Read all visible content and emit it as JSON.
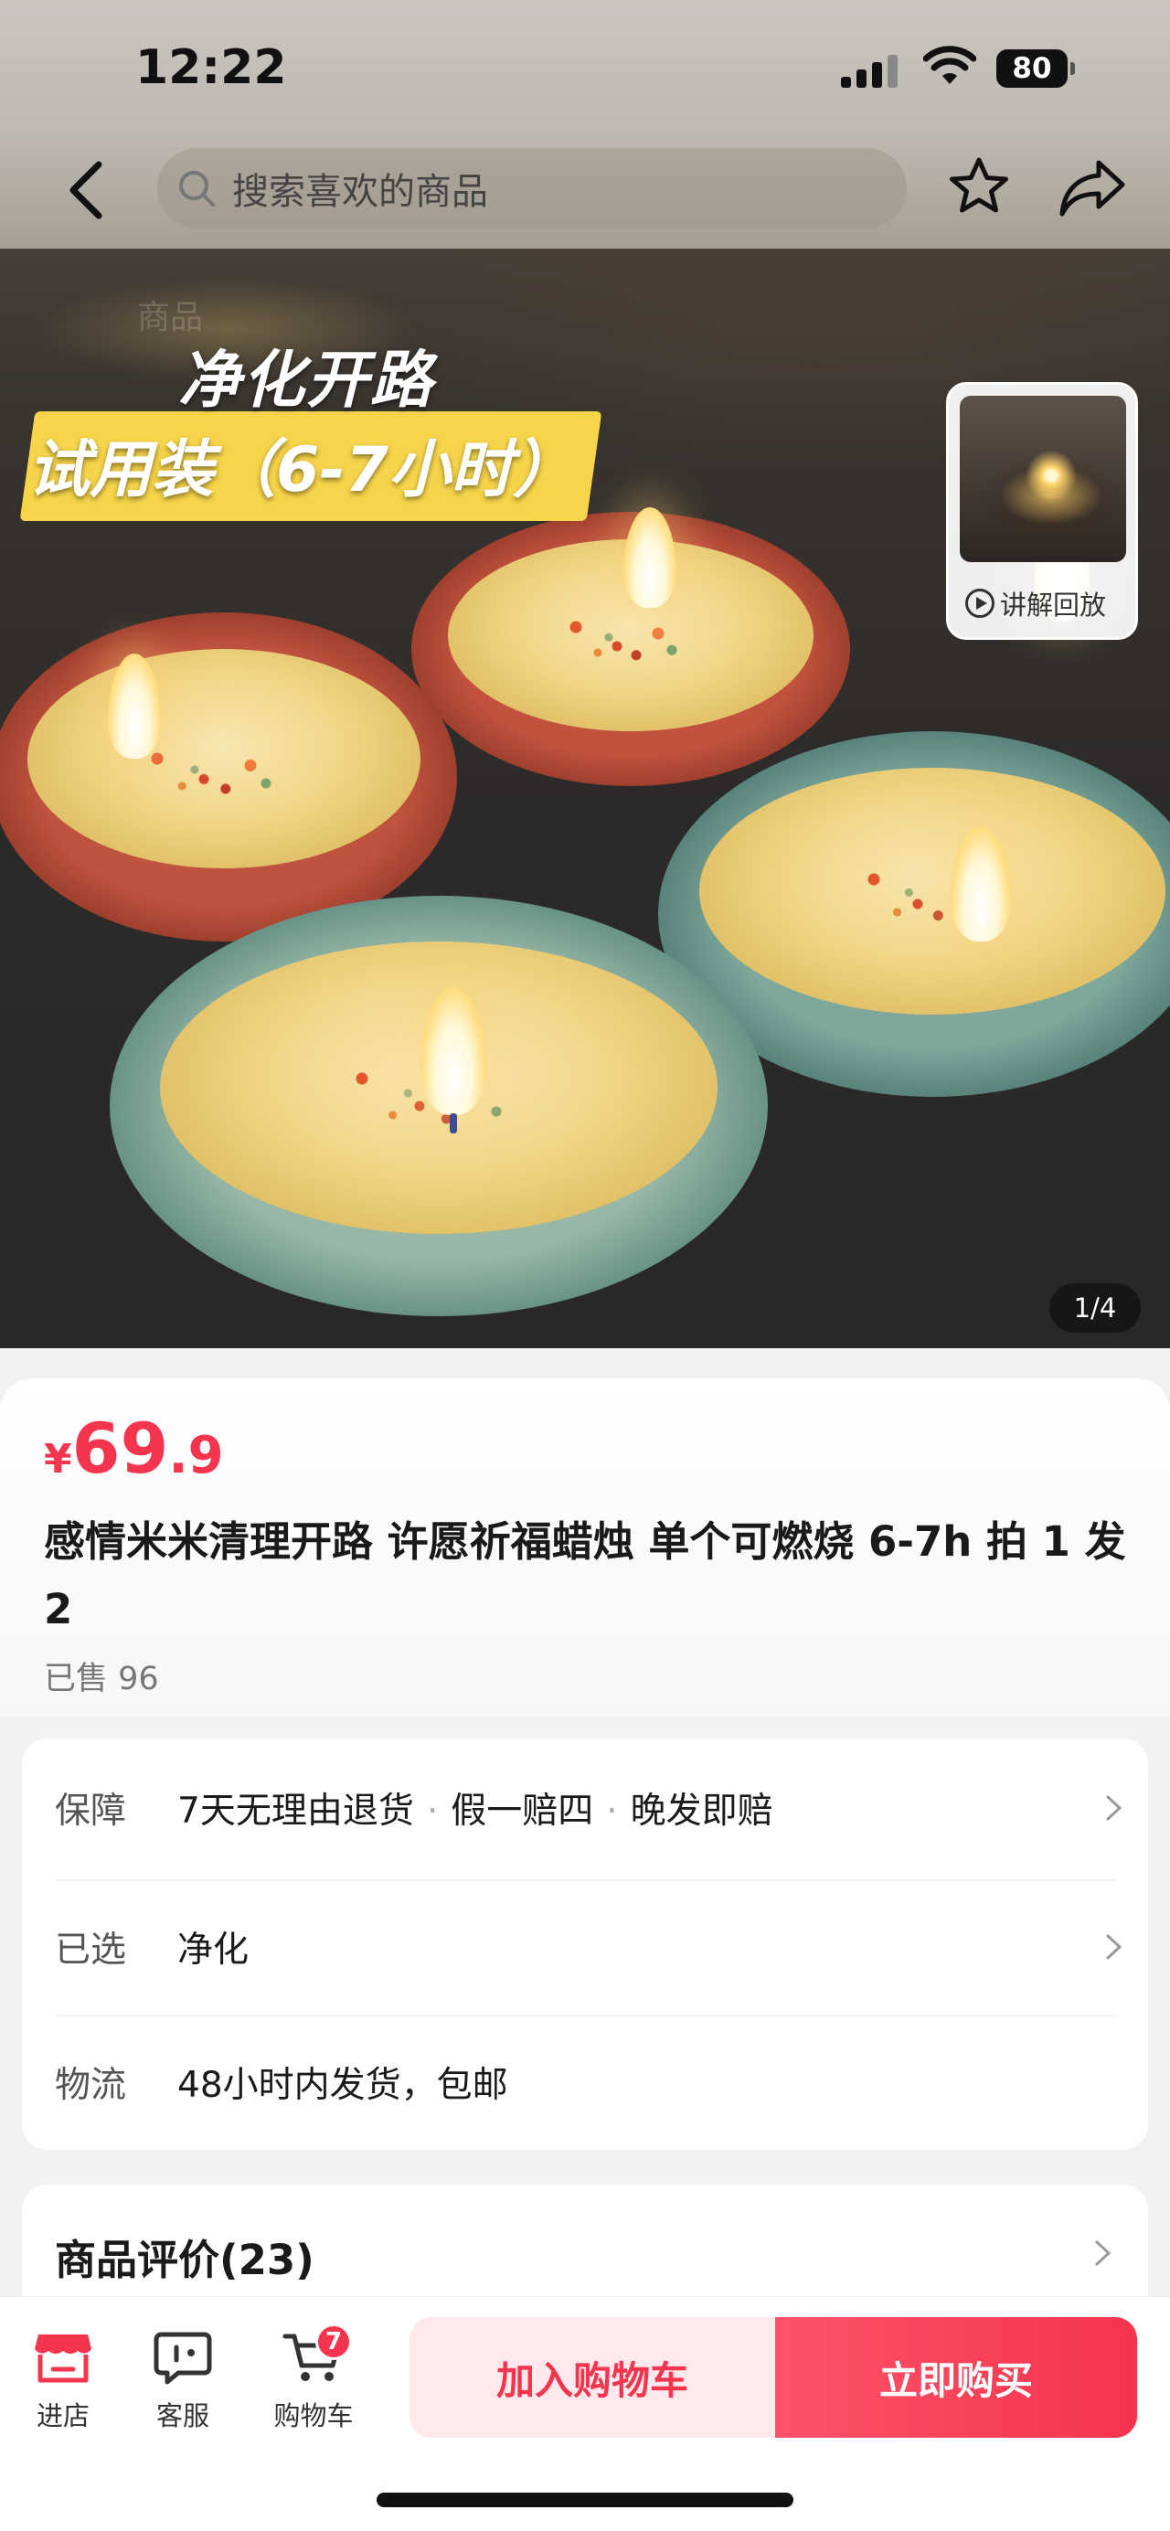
{
  "status_bar": {
    "time": "12:22",
    "battery": "80"
  },
  "nav": {
    "search_placeholder": "搜索喜欢的商品"
  },
  "hero": {
    "faint_text": "商品",
    "overlay_title": "净化开路",
    "overlay_subtitle": "试用装（6-7小时）",
    "replay_label": "讲解回放",
    "page_indicator": "1/4"
  },
  "product": {
    "price_symbol": "¥",
    "price_integer": "69",
    "price_decimal": ".9",
    "title": "感情米米清理开路 许愿祈福蜡烛 单个可燃烧 6-7h 拍 1 发 2",
    "sold": "已售 96"
  },
  "services": {
    "guarantee_label": "保障",
    "guarantee_items": [
      "7天无理由退货",
      "假一赔四",
      "晚发即赔"
    ],
    "guarantee_sep": "·",
    "selected_label": "已选",
    "selected_value": "净化",
    "shipping_label": "物流",
    "shipping_value": "48小时内发货，包邮"
  },
  "reviews": {
    "title": "商品评价(23)"
  },
  "bottom_bar": {
    "store_label": "进店",
    "service_label": "客服",
    "cart_label": "购物车",
    "cart_count": "7",
    "add_to_cart": "加入购物车",
    "buy_now": "立即购买"
  },
  "colors": {
    "accent": "#f5344e",
    "accent_light": "#ffe9ec"
  }
}
